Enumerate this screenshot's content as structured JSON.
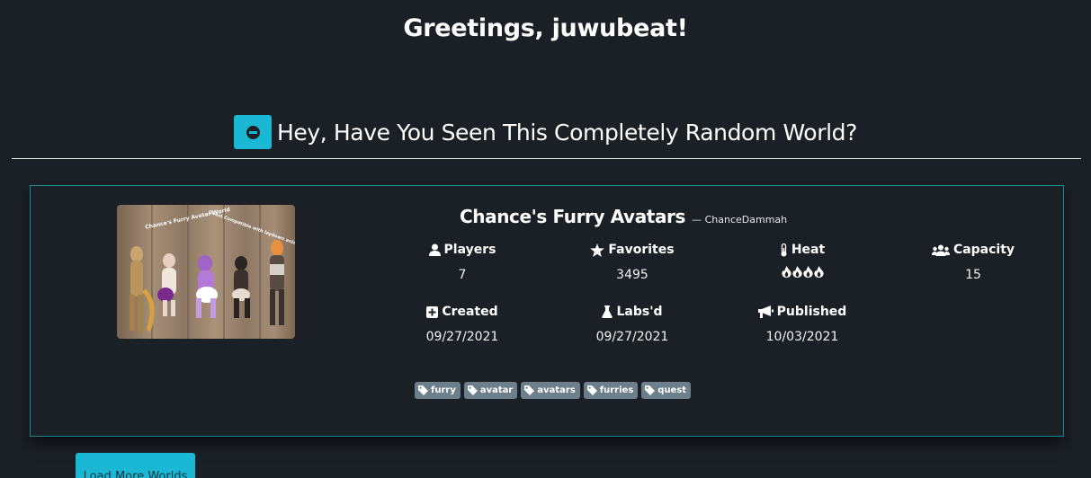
{
  "greeting": "Greetings, juwubeat!",
  "section": {
    "title": "Hey, Have You Seen This Completely Random World?",
    "toggle_icon": "minus-circle-icon"
  },
  "world": {
    "name": "Chance's Furry Avatars",
    "author": "— ChanceDammah",
    "thumbnail": {
      "caption_left": "Chance's Furry Avatar World",
      "caption_right": "Quest Compatible with laydown animations!"
    },
    "stats": {
      "players": {
        "label": "Players",
        "value": "7",
        "icon": "user-icon"
      },
      "favorites": {
        "label": "Favorites",
        "value": "3495",
        "icon": "star-icon"
      },
      "heat": {
        "label": "Heat",
        "value": 4,
        "icon": "thermometer-icon",
        "value_icon": "fire-icon"
      },
      "capacity": {
        "label": "Capacity",
        "value": "15",
        "icon": "users-icon"
      },
      "created": {
        "label": "Created",
        "value": "09/27/2021",
        "icon": "plus-square-icon"
      },
      "labsd": {
        "label": "Labs'd",
        "value": "09/27/2021",
        "icon": "flask-icon"
      },
      "published": {
        "label": "Published",
        "value": "10/03/2021",
        "icon": "megaphone-icon"
      }
    },
    "tags": [
      "furry",
      "avatar",
      "avatars",
      "furries",
      "quest"
    ]
  },
  "load_more_label": "Load More Worlds",
  "colors": {
    "background": "#1b1f26",
    "accent": "#1bb8d6",
    "card_border": "#1a8a8a",
    "tag_bg": "#6e7f8c"
  }
}
